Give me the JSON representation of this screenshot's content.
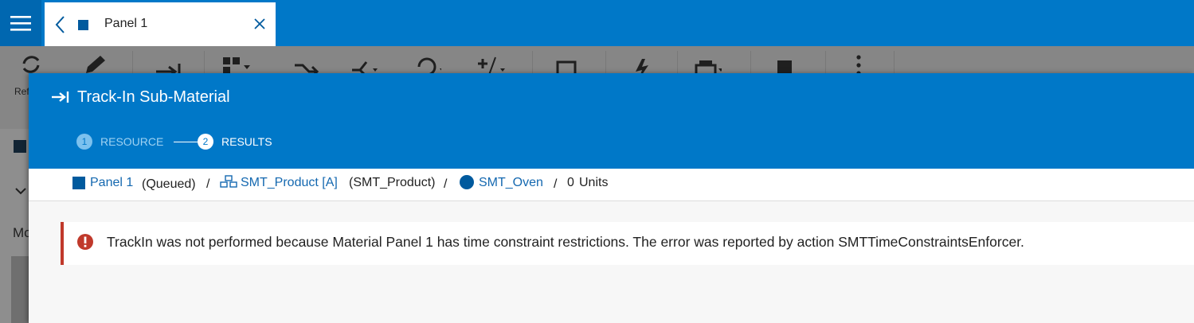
{
  "tab": {
    "label": "Panel 1"
  },
  "toolbar": {
    "partial_label": "Ref"
  },
  "background": {
    "partial_text": "Mo"
  },
  "modal": {
    "title": "Track-In Sub-Material",
    "steps": [
      {
        "number": "1",
        "label": "RESOURCE"
      },
      {
        "number": "2",
        "label": "RESULTS"
      }
    ]
  },
  "breadcrumb": {
    "material": "Panel 1",
    "material_state": "(Queued)",
    "sep1": "/",
    "product": "SMT_Product [A]",
    "product_name": "(SMT_Product)",
    "sep2": "/",
    "resource": "SMT_Oven",
    "sep3": "/",
    "units_count": "0",
    "units_label": "Units"
  },
  "error": {
    "message": "TrackIn was not performed because Material Panel 1 has time constraint restrictions. The error was reported by action SMTTimeConstraintsEnforcer."
  },
  "colors": {
    "brand": "#0078c8",
    "brand_dark": "#005a9e",
    "link": "#1468b0",
    "error": "#c0392b"
  },
  "icons": [
    "menu-icon",
    "back-icon",
    "material-icon",
    "close-icon",
    "refresh-icon",
    "edit-icon",
    "track-in-icon",
    "track-in-header-icon",
    "product-icon",
    "resource-icon",
    "error-icon"
  ]
}
